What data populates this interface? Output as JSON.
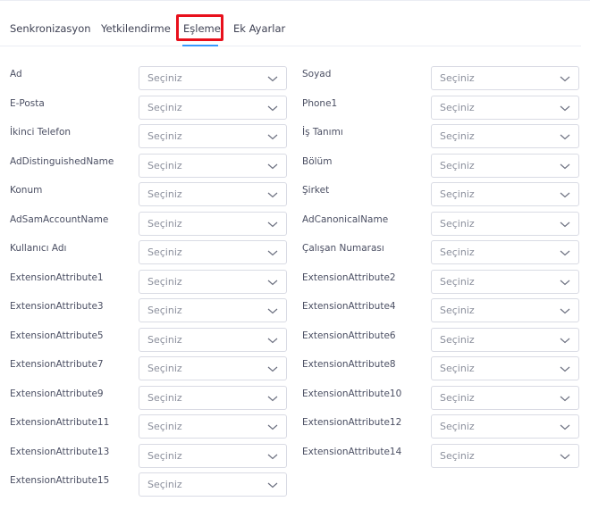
{
  "tabs": [
    {
      "label": "Senkronizasyon"
    },
    {
      "label": "Yetkilendirme"
    },
    {
      "label": "Eşleme"
    },
    {
      "label": "Ek Ayarlar"
    }
  ],
  "active_tab": "Eşleme",
  "select_placeholder": "Seçiniz",
  "fields_left": [
    "Ad",
    "E-Posta",
    "İkinci Telefon",
    "AdDistinguishedName",
    "Konum",
    "AdSamAccountName",
    "Kullanıcı Adı",
    "ExtensionAttribute1",
    "ExtensionAttribute3",
    "ExtensionAttribute5",
    "ExtensionAttribute7",
    "ExtensionAttribute9",
    "ExtensionAttribute11",
    "ExtensionAttribute13",
    "ExtensionAttribute15"
  ],
  "fields_right": [
    "Soyad",
    "Phone1",
    "İş Tanımı",
    "Bölüm",
    "Şirket",
    "AdCanonicalName",
    "Çalışan Numarası",
    "ExtensionAttribute2",
    "ExtensionAttribute4",
    "ExtensionAttribute6",
    "ExtensionAttribute8",
    "ExtensionAttribute10",
    "ExtensionAttribute12",
    "ExtensionAttribute14"
  ],
  "colors": {
    "active_underline": "#3699ff",
    "highlight_box": "#e8101c"
  },
  "icons": {
    "select_chevron": "chevron-down-icon"
  }
}
